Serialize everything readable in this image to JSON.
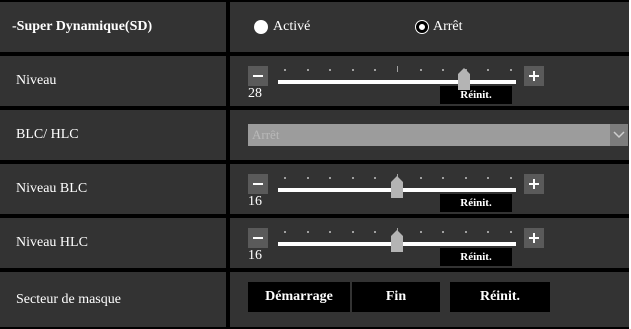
{
  "super_dynamique": {
    "label": "-Super Dynamique(SD)",
    "options": [
      "Activé",
      "Arrêt"
    ],
    "selected": "Arrêt"
  },
  "niveau": {
    "label": "Niveau",
    "value": "28",
    "level": 0.78,
    "reset": "Réinit."
  },
  "blc_hlc": {
    "label": "BLC/ HLC",
    "selected": "Arrêt"
  },
  "niveau_blc": {
    "label": "Niveau BLC",
    "value": "16",
    "level": 0.5,
    "reset": "Réinit."
  },
  "niveau_hlc": {
    "label": "Niveau HLC",
    "value": "16",
    "level": 0.5,
    "reset": "Réinit."
  },
  "secteur_masque": {
    "label": "Secteur de masque",
    "buttons": [
      "Démarrage",
      "Fin",
      "Réinit."
    ]
  },
  "colors": {
    "label_bg": "#333333",
    "panel_border": "#000000",
    "button_bg": "#5a5a5a",
    "thumb": "#b4b4b4"
  },
  "icons": {
    "minus": "minus-icon",
    "plus": "plus-icon",
    "dropdown": "chevron-down-icon"
  }
}
